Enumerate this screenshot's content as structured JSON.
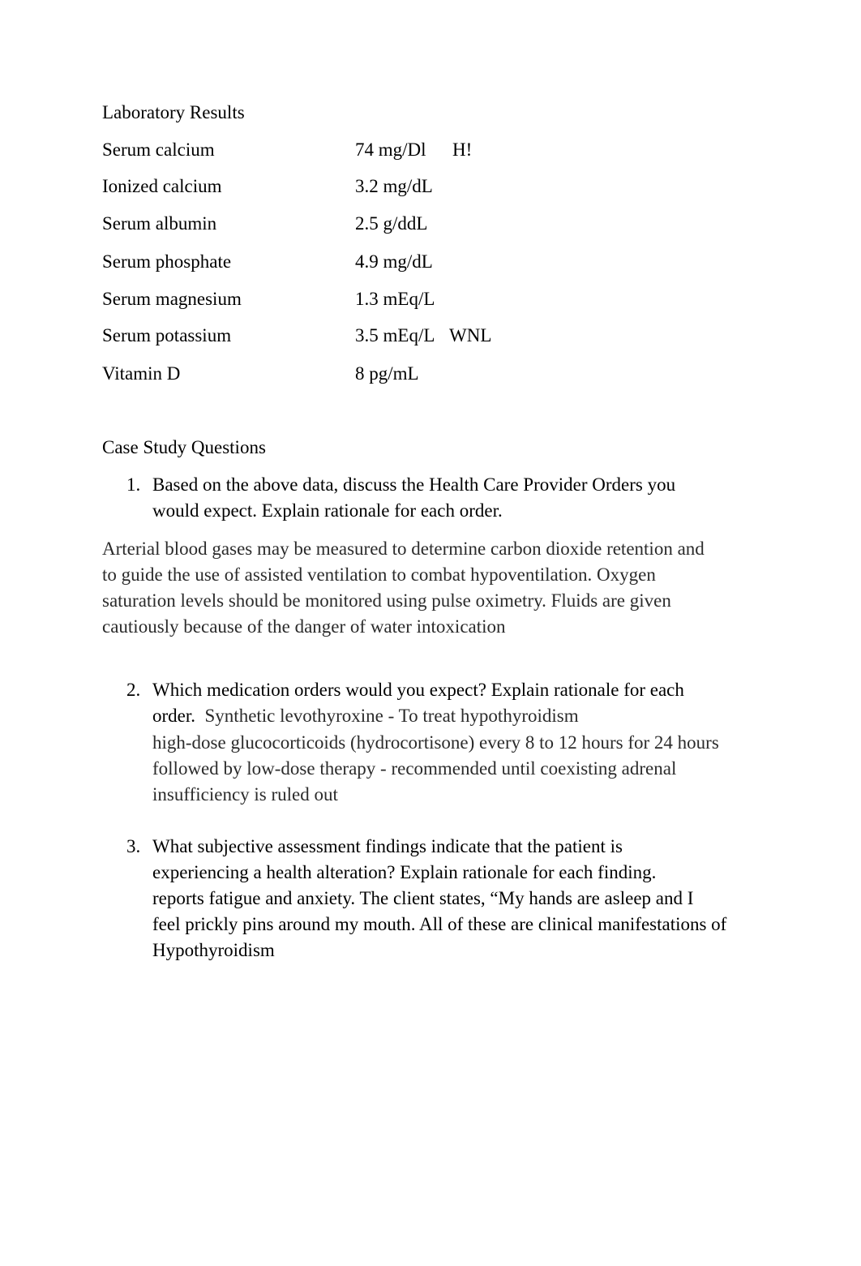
{
  "document": {
    "lab_section": {
      "title": "Laboratory Results",
      "rows": [
        {
          "name": "Serum calcium",
          "value": "74 mg/Dl",
          "flag": "H!"
        },
        {
          "name": "Ionized calcium",
          "value": "3.2 mg/dL",
          "flag": ""
        },
        {
          "name": "Serum albumin",
          "value": "2.5 g/ddL",
          "flag": ""
        },
        {
          "name": "Serum phosphate",
          "value": "4.9 mg/dL",
          "flag": ""
        },
        {
          "name": "Serum magnesium",
          "value": "1.3 mEq/L",
          "flag": ""
        },
        {
          "name": "Serum potassium",
          "value": "3.5 mEq/L",
          "flag": "WNL"
        },
        {
          "name": "Vitamin D",
          "value": "8 pg/mL",
          "flag": ""
        }
      ]
    },
    "questions_section": {
      "title": "Case Study Questions",
      "questions": [
        {
          "number": "1.",
          "lines": [
            "Based on the above data, discuss the Health Care Provider Orders you",
            "would expect.  Explain rationale for each order."
          ],
          "answer_lines": [
            "Arterial blood gases may be measured to determine carbon dioxide retention and",
            "to guide the use of assisted ventilation to combat hypoventilation. Oxygen",
            "saturation levels should be monitored using pulse oximetry. Fluids are given",
            "cautiously because of the danger of water intoxication"
          ]
        },
        {
          "number": "2.",
          "question_line_1": "Which medication orders would you expect?  Explain rationale for each",
          "question_line_2_prefix": "order.",
          "answer_line_2": "Synthetic levothyroxine - To treat hypothyroidism",
          "answer_lines": [
            "high-dose glucocorticoids (hydrocortisone) every 8 to 12 hours for 24 hours",
            "followed by low-dose therapy  - recommended until coexisting adrenal",
            "insufficiency is ruled out"
          ]
        },
        {
          "number": "3.",
          "lines": [
            "What subjective assessment findings indicate that the patient is",
            "experiencing a health alteration?   Explain rationale for each finding."
          ],
          "answer_lines": [
            "reports fatigue and anxiety.   The client states, “My hands are asleep and I",
            "feel prickly pins around my mouth. All of these are clinical manifestations of",
            "Hypothyroidism"
          ]
        }
      ]
    }
  }
}
